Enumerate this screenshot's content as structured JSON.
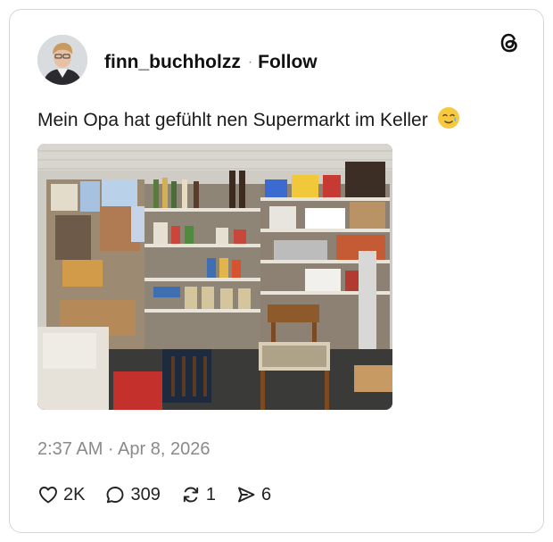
{
  "post": {
    "username": "finn_buchholzz",
    "separator": "·",
    "follow_label": "Follow",
    "text": "Mein Opa hat gefühlt nen Supermarkt im Keller",
    "emoji_icon": "smiling-face-with-tear",
    "timestamp": "2:37 AM · Apr 8, 2026"
  },
  "actions": {
    "likes": "2K",
    "replies": "309",
    "reposts": "1",
    "shares": "6"
  },
  "colors": {
    "text": "#111111",
    "muted": "#8a8a8a",
    "border": "#d6d6d6"
  }
}
